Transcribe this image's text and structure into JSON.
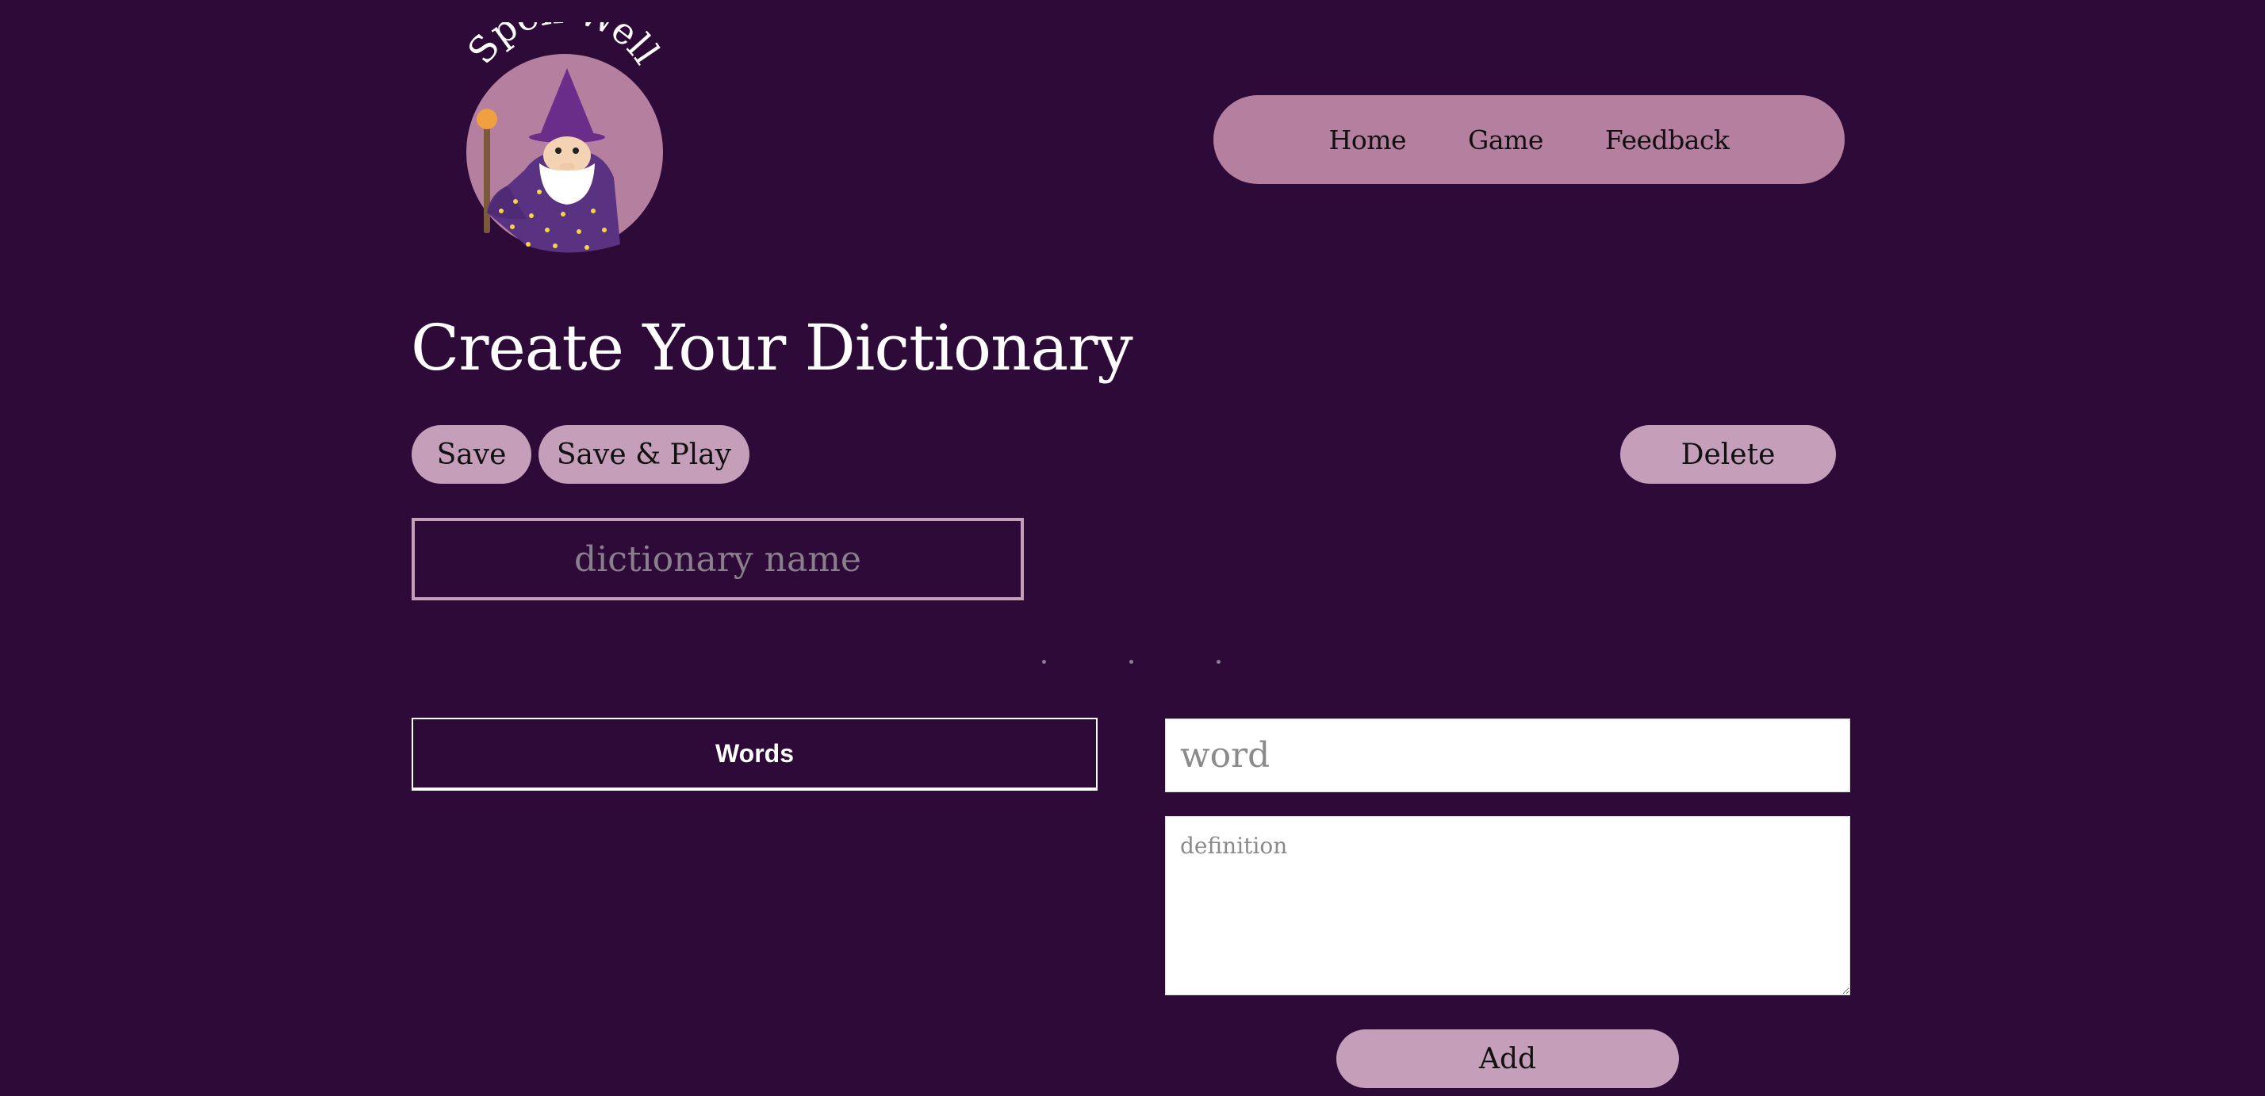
{
  "logo": {
    "text": "Spell Well",
    "colors": {
      "circle": "#b57fa0",
      "hat": "#6a2e8a",
      "robe": "#5a3282",
      "beard": "#ffffff",
      "staff": "#7a5a3a",
      "orb": "#f0a040",
      "stars": "#f5d44a"
    }
  },
  "nav": {
    "items": [
      {
        "label": "Home"
      },
      {
        "label": "Game"
      },
      {
        "label": "Feedback"
      }
    ]
  },
  "page": {
    "title": "Create Your Dictionary"
  },
  "toolbar": {
    "save_label": "Save",
    "save_play_label": "Save & Play",
    "delete_label": "Delete"
  },
  "dictionary": {
    "name_placeholder": "dictionary name",
    "name_value": ""
  },
  "words": {
    "header": "Words",
    "items": []
  },
  "entry": {
    "word_placeholder": "word",
    "word_value": "",
    "definition_placeholder": "definition",
    "definition_value": "",
    "add_label": "Add"
  },
  "colors": {
    "background": "#2d0a37",
    "nav_bg": "#b57fa0",
    "button_bg": "#c59fba",
    "text_light": "#ffffff"
  }
}
